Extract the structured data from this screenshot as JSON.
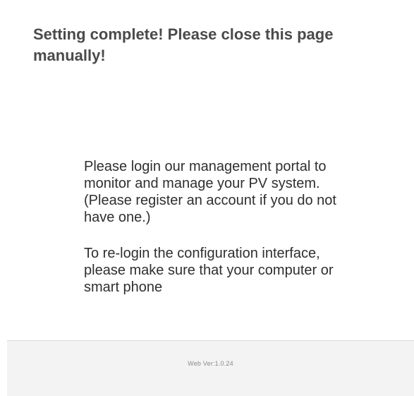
{
  "header": {
    "title": "Setting complete! Please close this page manually!"
  },
  "message": {
    "paragraph1": "Please login our management portal to monitor and manage your PV system.(Please register an account if you do not have one.)",
    "paragraph2": "To re-login the configuration interface, please make sure that your computer or smart phone"
  },
  "footer": {
    "version": "Web Ver:1.0.24"
  }
}
